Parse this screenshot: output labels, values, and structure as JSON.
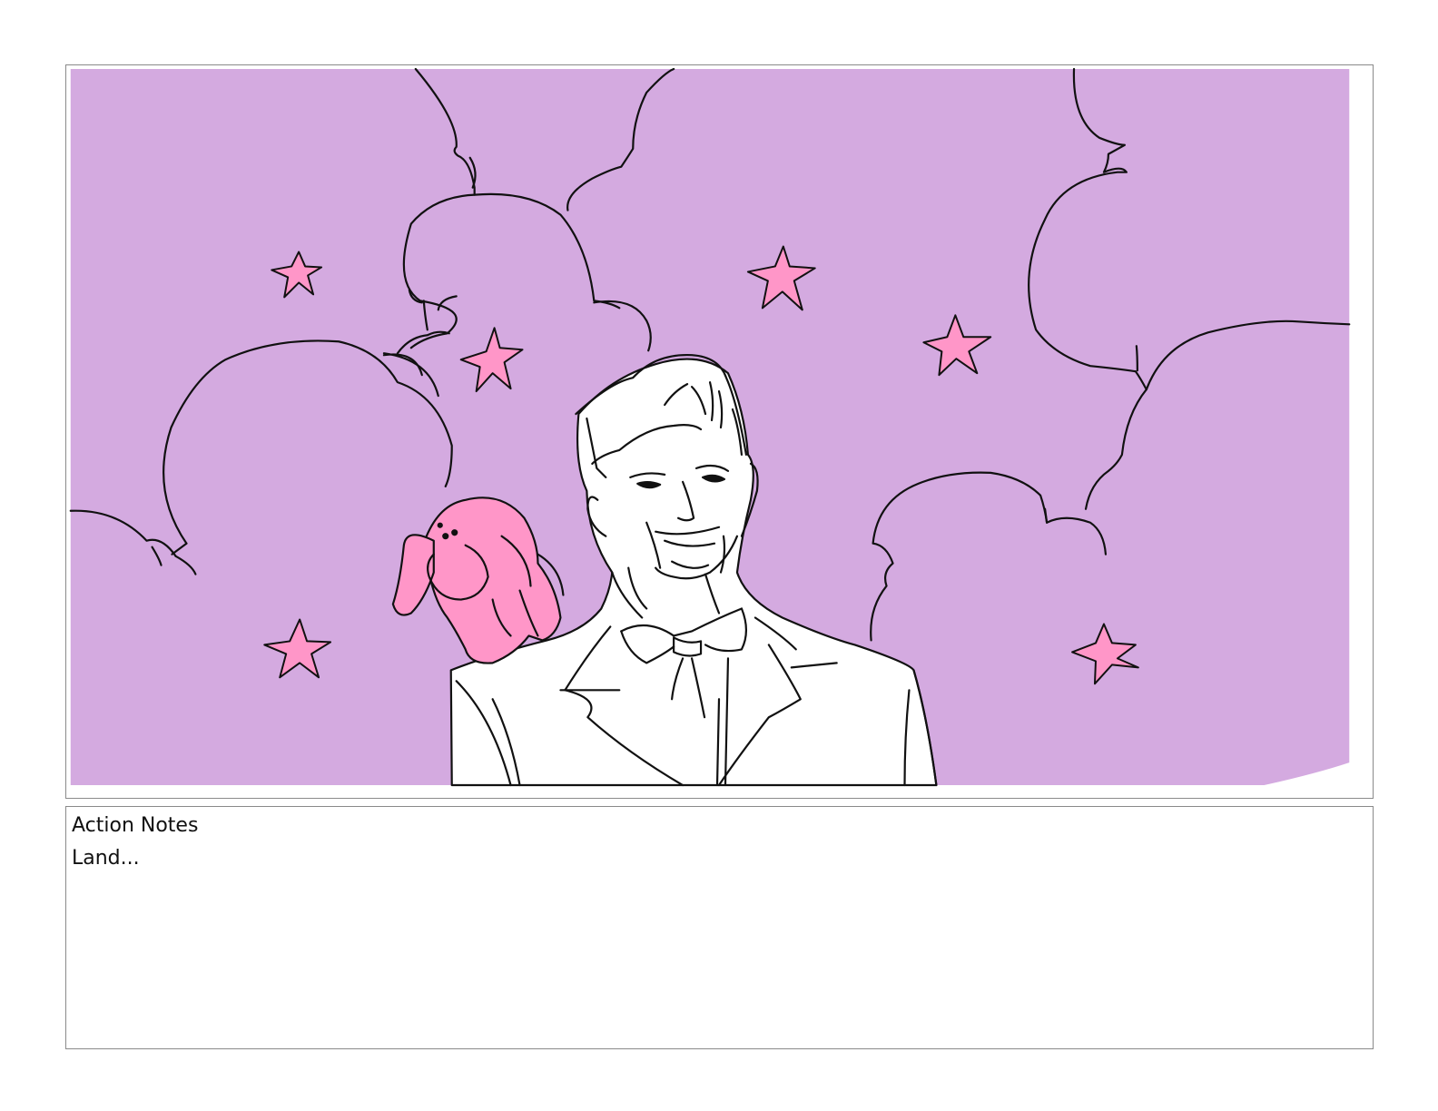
{
  "panel": {
    "background_color": "#d4aae0",
    "accent_pink": "#ff96c8",
    "figure_fill": "#ffffff",
    "line_color": "#111111"
  },
  "notes": {
    "label": "Action Notes",
    "text": "Land..."
  }
}
